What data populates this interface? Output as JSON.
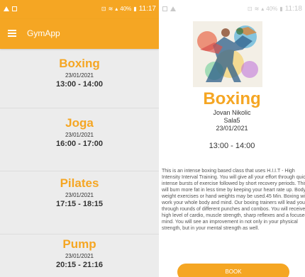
{
  "left": {
    "status": {
      "battery": "40%",
      "time": "11:17"
    },
    "app_title": "GymApp",
    "classes": [
      {
        "name": "Boxing",
        "date": "23/01/2021",
        "time": "13:00 - 14:00"
      },
      {
        "name": "Joga",
        "date": "23/01/2021",
        "time": "16:00 - 17:00"
      },
      {
        "name": "Pilates",
        "date": "23/01/2021",
        "time": "17:15 - 18:15"
      },
      {
        "name": "Pump",
        "date": "23/01/2021",
        "time": "20:15 - 21:16"
      }
    ]
  },
  "right": {
    "status": {
      "battery": "40%",
      "time": "11:18"
    },
    "detail": {
      "name": "Boxing",
      "trainer": "Jovan Nikolic",
      "room": "Sala5",
      "date": "23/01/2021",
      "time": "13:00 - 14:00",
      "description": "This is an intense boxing based class that uses H.I.I.T - High Intensity Interval Training. You will give all your effort through quick, intense bursts of exercise followed by short recovery periods. This will burn more fat in less time by keeping your heart rate up. Body weight exercises or hand weights may be used.45 Min. Boxing will work your whole body and mind. Our boxing trainers will lead you through rounds of different punches and combos. You will receive a high level of cardio, muscle strength, sharp reflexes and a focused mind. You will see an improvement in not only in your physical strength, but in your mental strength as well.",
      "book_label": "BOOK"
    }
  },
  "colors": {
    "accent": "#f5a623",
    "list_background": "#ececec",
    "text": "#333333"
  },
  "icons": {
    "menu": "hamburger-menu-icon"
  }
}
